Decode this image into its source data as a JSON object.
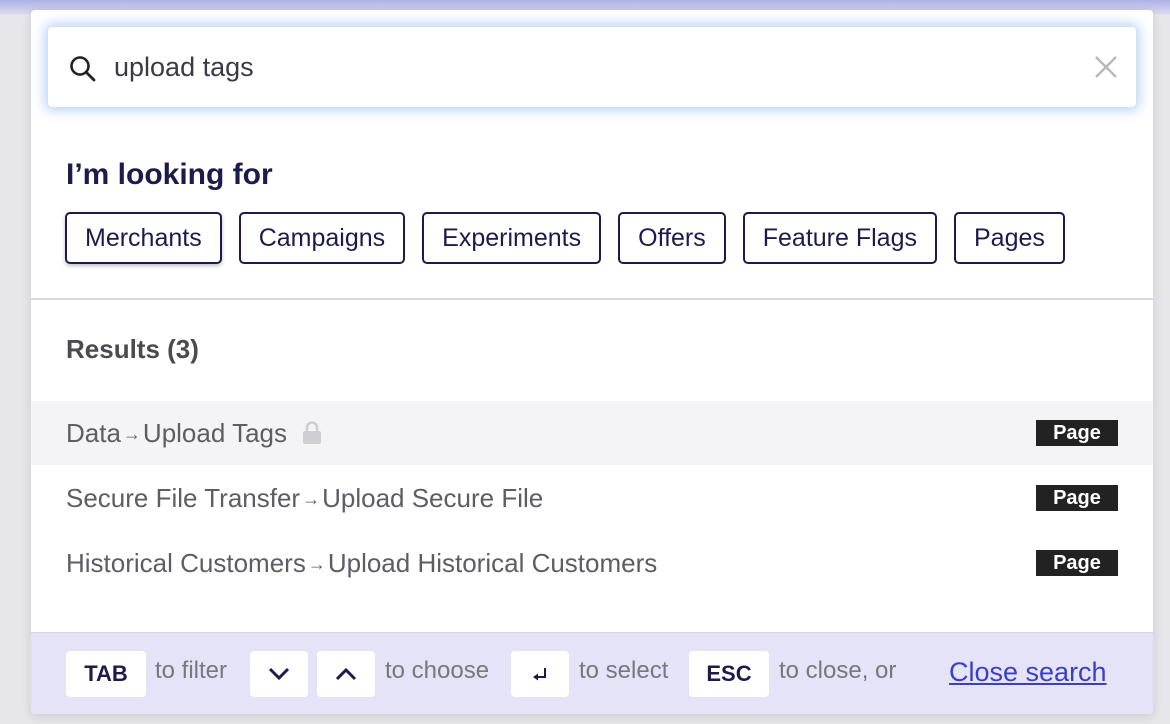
{
  "search": {
    "value": "upload tags",
    "search_icon": "search-icon",
    "clear_icon": "close-icon"
  },
  "filter": {
    "heading": "I’m looking for",
    "chips": [
      "Merchants",
      "Campaigns",
      "Experiments",
      "Offers",
      "Feature Flags",
      "Pages"
    ]
  },
  "results": {
    "title": "Results (3)",
    "items": [
      {
        "section": "Data",
        "page": "Upload Tags",
        "locked": true,
        "badge": "Page"
      },
      {
        "section": "Secure File Transfer",
        "page": "Upload Secure File",
        "locked": false,
        "badge": "Page"
      },
      {
        "section": "Historical Customers",
        "page": "Upload Historical Customers",
        "locked": false,
        "badge": "Page"
      }
    ],
    "arrow": "→"
  },
  "footer": {
    "tab_key": "TAB",
    "tab_hint": "to filter",
    "down_icon": "chevron-down-icon",
    "up_icon": "chevron-up-icon",
    "choose_hint": "to choose",
    "enter_icon": "enter-icon",
    "select_hint": "to select",
    "esc_key": "ESC",
    "esc_hint": "to close, or",
    "close_link": "Close search"
  },
  "colors": {
    "accent": "#1e1b4b",
    "link": "#3b3ec8",
    "footer_bg": "#e4e3f8",
    "badge_bg": "#222222"
  }
}
